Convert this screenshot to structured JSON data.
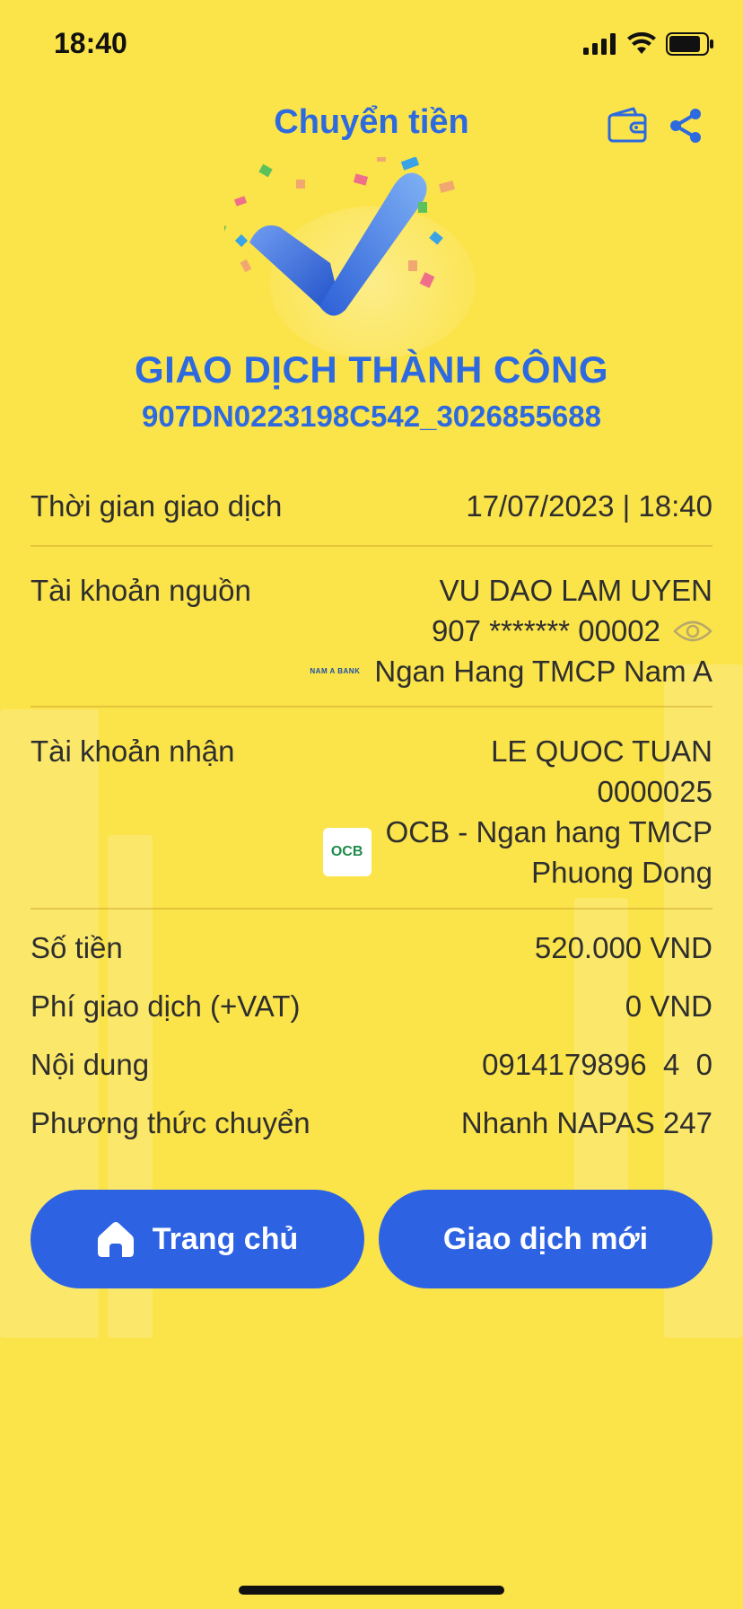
{
  "status_bar": {
    "time": "18:40"
  },
  "header": {
    "title": "Chuyển tiền"
  },
  "result": {
    "title": "GIAO DỊCH THÀNH CÔNG",
    "transaction_id": "907DN0223198C542_3026855688"
  },
  "details": {
    "time": {
      "label": "Thời gian giao dịch",
      "value": "17/07/2023 | 18:40"
    },
    "source": {
      "label": "Tài khoản nguồn",
      "name": "VU DAO LAM UYEN",
      "account": "907 ******* 00002",
      "bank_logo": "NAM A BANK",
      "bank": "Ngan Hang TMCP Nam A"
    },
    "receiver": {
      "label": "Tài khoản nhận",
      "name": "LE QUOC TUAN",
      "account": "0000025",
      "bank_logo": "OCB",
      "bank_line1": "OCB - Ngan hang TMCP",
      "bank_line2": "Phuong Dong"
    },
    "amount": {
      "label": "Số tiền",
      "value": "520.000 VND"
    },
    "fee": {
      "label": "Phí giao dịch (+VAT)",
      "value": "0 VND"
    },
    "content": {
      "label": "Nội dung",
      "value": "0914179896  4  0"
    },
    "method": {
      "label": "Phương thức chuyển",
      "value": "Nhanh NAPAS 247"
    }
  },
  "buttons": {
    "home": "Trang chủ",
    "new_transaction": "Giao dịch mới"
  },
  "colors": {
    "background": "#fbe34a",
    "accent": "#2d6ae0",
    "button": "#2d63e3"
  },
  "icons": [
    "signal-icon",
    "wifi-icon",
    "battery-icon",
    "wallet-icon",
    "share-icon",
    "checkmark-icon",
    "eye-icon",
    "home-icon"
  ]
}
